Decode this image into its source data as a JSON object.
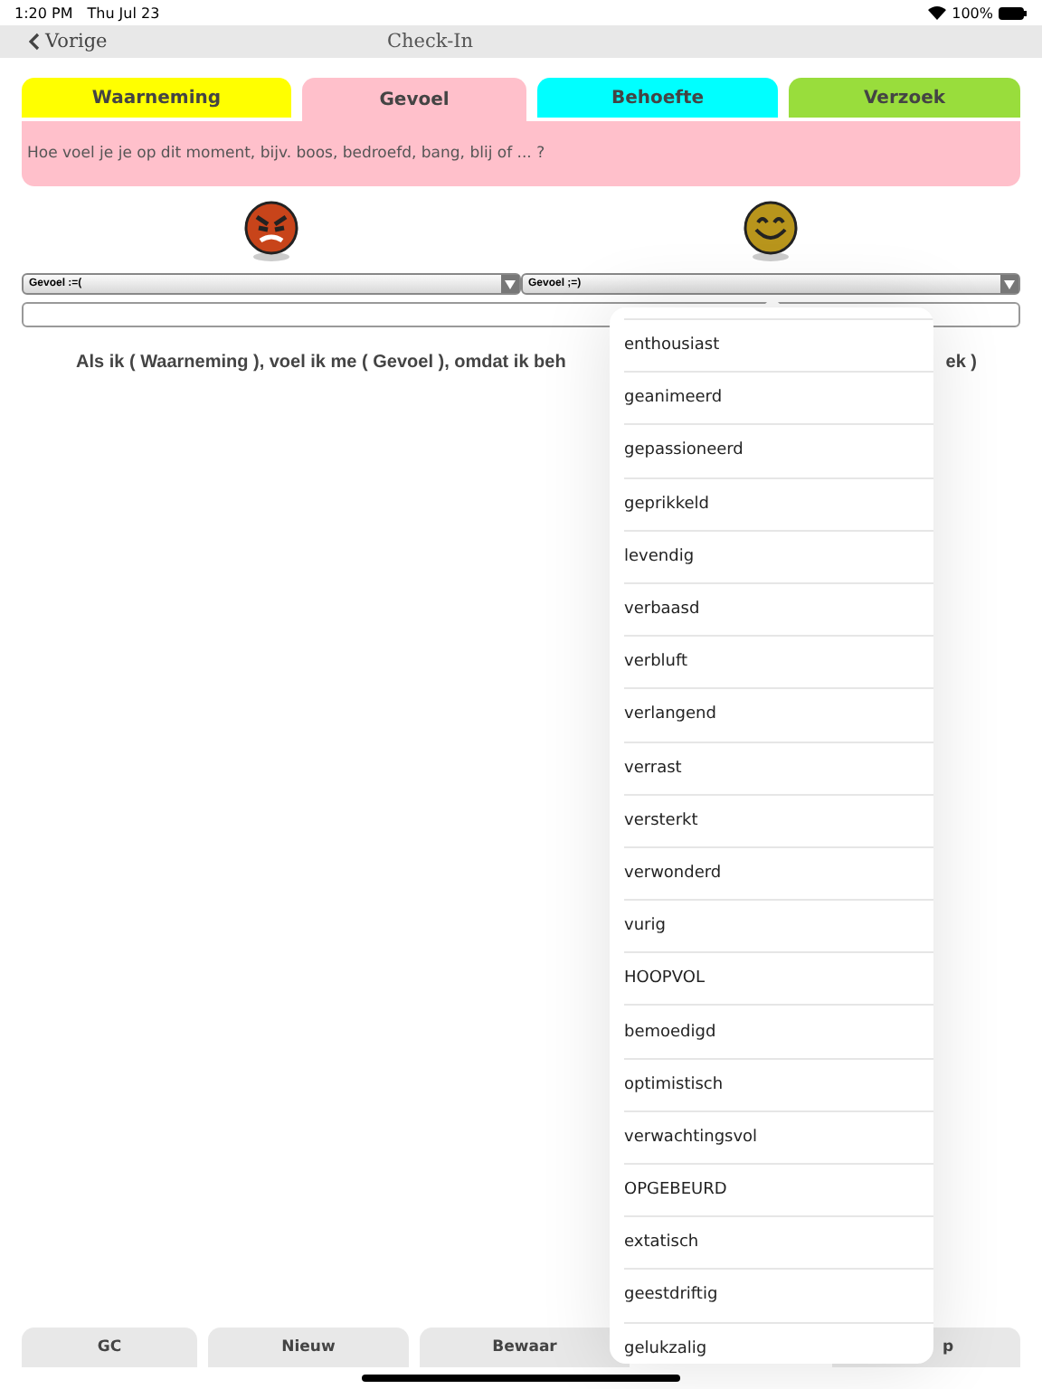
{
  "status_bar": {
    "time": "1:20 PM",
    "date": "Thu Jul 23",
    "battery": "100%"
  },
  "nav": {
    "back": "Vorige",
    "title": "Check-In"
  },
  "tabs": [
    {
      "label": "Waarneming",
      "selected": false,
      "color": "#ffff00"
    },
    {
      "label": "Gevoel",
      "selected": true,
      "color": "#ffc0cb"
    },
    {
      "label": "Behoefte",
      "selected": false,
      "color": "#00ffff"
    },
    {
      "label": "Verzoek",
      "selected": false,
      "color": "#99dd3c"
    }
  ],
  "prompt": "Hoe voel je je op dit moment, bijv. boos, bedroefd, bang, blij of ... ?",
  "pickers": [
    {
      "kind": "angry",
      "value": "Gevoel :=("
    },
    {
      "kind": "happy",
      "value": "Gevoel ;=)"
    }
  ],
  "sentence": {
    "start": "Als ik ( Waarneming ), voel ik me ( Gevoel ), omdat ik beh",
    "end": "ek )"
  },
  "popover_items": [
    "enthousiast",
    "geanimeerd",
    "gepassioneerd",
    "geprikkeld",
    "levendig",
    "verbaasd",
    "verbluft",
    "verlangend",
    "verrast",
    "versterkt",
    "verwonderd",
    "vurig",
    "HOOPVOL",
    "bemoedigd",
    "optimistisch",
    "verwachtingsvol",
    "OPGEBEURD",
    "extatisch",
    "geestdriftig",
    "gelukzalig"
  ],
  "bottom_buttons": [
    "GC",
    "Nieuw",
    "Bewaar",
    "p"
  ]
}
